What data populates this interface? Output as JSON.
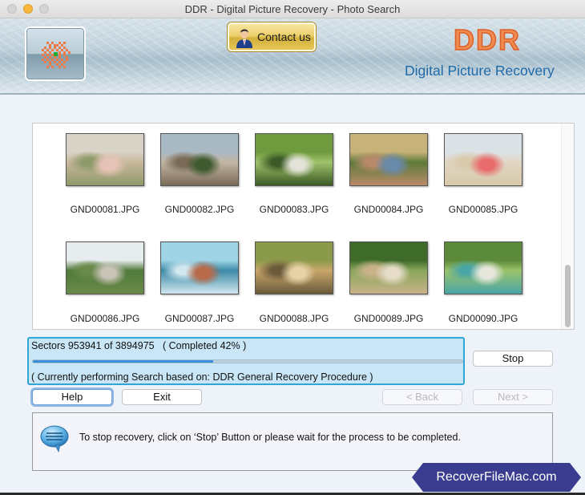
{
  "window": {
    "title": "DDR - Digital Picture Recovery - Photo Search"
  },
  "banner": {
    "logo_icon": "ddr-logo-icon",
    "contact_button_label": "Contact us",
    "contact_icon": "person-icon",
    "brand_name": "DDR",
    "brand_subtitle": "Digital Picture Recovery",
    "colors": {
      "brand_orange": "#f08a4e",
      "subtitle_blue": "#1f6aa8"
    }
  },
  "photos": [
    {
      "name": "GND00081.JPG",
      "scene": "family on beach dunes"
    },
    {
      "name": "GND00082.JPG",
      "scene": "person with pig"
    },
    {
      "name": "GND00083.JPG",
      "scene": "hikers in forest"
    },
    {
      "name": "GND00084.JPG",
      "scene": "group of kids outdoors"
    },
    {
      "name": "GND00085.JPG",
      "scene": "beach cleanup"
    },
    {
      "name": "GND00086.JPG",
      "scene": "seniors hiking coastal trail"
    },
    {
      "name": "GND00087.JPG",
      "scene": "hiker overlooking mountains"
    },
    {
      "name": "GND00088.JPG",
      "scene": "couple walking park path"
    },
    {
      "name": "GND00089.JPG",
      "scene": "crowd picnic on lawn"
    },
    {
      "name": "GND00090.JPG",
      "scene": "birdwatchers with binoculars"
    }
  ],
  "progress": {
    "sectors_text": "Sectors 953941 of 3894975   ( Completed 42% )",
    "sectors_done": 953941,
    "sectors_total": 3894975,
    "percent_complete": 42,
    "procedure_text": "( Currently performing Search based on: DDR General Recovery Procedure )",
    "colors": {
      "fill": "#3b8fdc",
      "panel_border": "#2fa6d6"
    }
  },
  "buttons": {
    "stop": "Stop",
    "help": "Help",
    "exit": "Exit",
    "back": "< Back",
    "next": "Next >"
  },
  "info": {
    "icon": "chat-bubble-icon",
    "message": "To stop recovery, click on ‘Stop’ Button or please wait for the process to be completed."
  },
  "watermark": {
    "text": "RecoverFileMac.com",
    "color": "#3a3d8f"
  }
}
